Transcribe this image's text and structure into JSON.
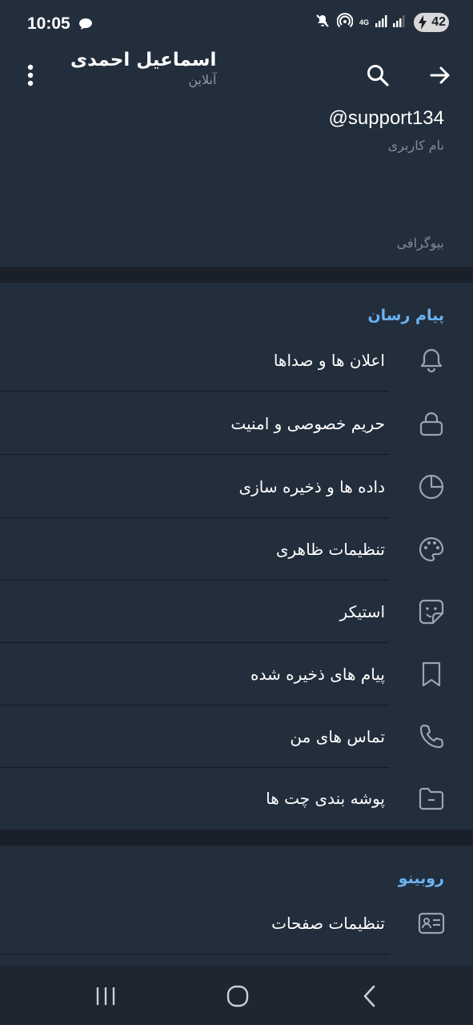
{
  "status_bar": {
    "time": "10:05",
    "network": "4G",
    "battery": "42",
    "icons": [
      "chat-bubble-icon",
      "mute-icon",
      "hotspot-icon",
      "signal-icon",
      "battery-icon"
    ]
  },
  "header": {
    "title": "اسماعیل احمدی",
    "subtitle": "آنلاین",
    "icons": [
      "more-vertical-icon",
      "search-icon",
      "arrow-right-icon"
    ]
  },
  "profile": {
    "username": "@support134",
    "username_label": "نام کاربری",
    "bio_label": "بیوگرافی"
  },
  "messenger_section": {
    "heading": "پیام رسان",
    "items": [
      {
        "label": "اعلان ها و صداها",
        "icon": "bell-icon"
      },
      {
        "label": "حریم خصوصی و امنیت",
        "icon": "lock-icon"
      },
      {
        "label": "داده ها و ذخیره سازی",
        "icon": "pie-chart-icon"
      },
      {
        "label": "تنظیمات ظاهری",
        "icon": "palette-icon"
      },
      {
        "label": "استیکر",
        "icon": "sticker-icon"
      },
      {
        "label": "پیام های ذخیره شده",
        "icon": "bookmark-icon"
      },
      {
        "label": "تماس های من",
        "icon": "phone-icon"
      },
      {
        "label": "پوشه بندی چت ها",
        "icon": "folder-icon"
      }
    ]
  },
  "rubino_section": {
    "heading": "روبینو",
    "items": [
      {
        "label": "تنظیمات صفحات",
        "icon": "id-card-icon"
      }
    ]
  },
  "nav_bar": {
    "icons": [
      "recent-apps-icon",
      "home-icon",
      "back-icon"
    ]
  },
  "colors": {
    "background": "#1a2029",
    "surface": "#232e3c",
    "accent": "#6ab3f3",
    "secondary_text": "#7f8b97",
    "icon": "#9aa5b1"
  }
}
